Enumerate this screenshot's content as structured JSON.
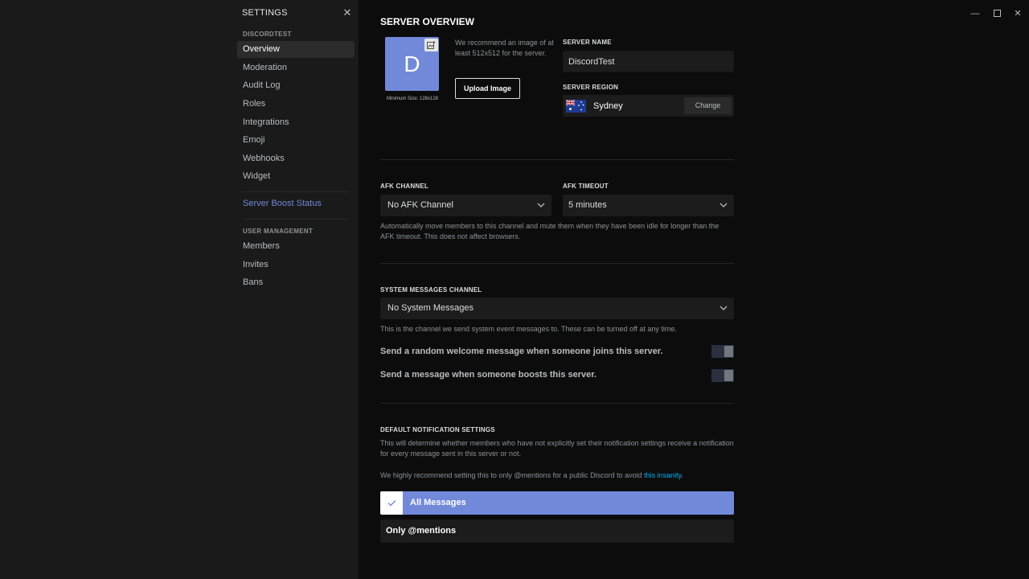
{
  "sidebar": {
    "title": "SETTINGS",
    "server_section": "DISCORDTEST",
    "items": [
      {
        "label": "Overview"
      },
      {
        "label": "Moderation"
      },
      {
        "label": "Audit Log"
      },
      {
        "label": "Roles"
      },
      {
        "label": "Integrations"
      },
      {
        "label": "Emoji"
      },
      {
        "label": "Webhooks"
      },
      {
        "label": "Widget"
      }
    ],
    "boost": "Server Boost Status",
    "user_section": "USER MANAGEMENT",
    "user_items": [
      {
        "label": "Members"
      },
      {
        "label": "Invites"
      },
      {
        "label": "Bans"
      }
    ]
  },
  "main": {
    "title": "SERVER OVERVIEW",
    "avatar_letter": "D",
    "min_size": "Minimum Size: 128x128",
    "recommend": "We recommend an image of at least 512x512 for the server.",
    "upload_label": "Upload Image",
    "server_name_label": "SERVER NAME",
    "server_name_value": "DiscordTest",
    "server_region_label": "SERVER REGION",
    "region_name": "Sydney",
    "change_label": "Change",
    "afk_channel_label": "AFK CHANNEL",
    "afk_channel_value": "No AFK Channel",
    "afk_timeout_label": "AFK TIMEOUT",
    "afk_timeout_value": "5 minutes",
    "afk_help": "Automatically move members to this channel and mute them when they have been idle for longer than the AFK timeout. This does not affect browsers.",
    "system_label": "SYSTEM MESSAGES CHANNEL",
    "system_value": "No System Messages",
    "system_help": "This is the channel we send system event messages to. These can be turned off at any time.",
    "toggle_welcome": "Send a random welcome message when someone joins this server.",
    "toggle_boost": "Send a message when someone boosts this server.",
    "notif_label": "DEFAULT NOTIFICATION SETTINGS",
    "notif_help": "This will determine whether members who have not explicitly set their notification settings receive a notification for every message sent in this server or not.",
    "notif_recommend_prefix": "We highly recommend setting this to only @mentions for a public Discord to avoid ",
    "notif_link": "this insanity",
    "notif_recommend_suffix": ".",
    "option_all": "All Messages",
    "option_mentions": "Only @mentions"
  },
  "colors": {
    "accent": "#7289da",
    "link": "#00b0f4"
  }
}
